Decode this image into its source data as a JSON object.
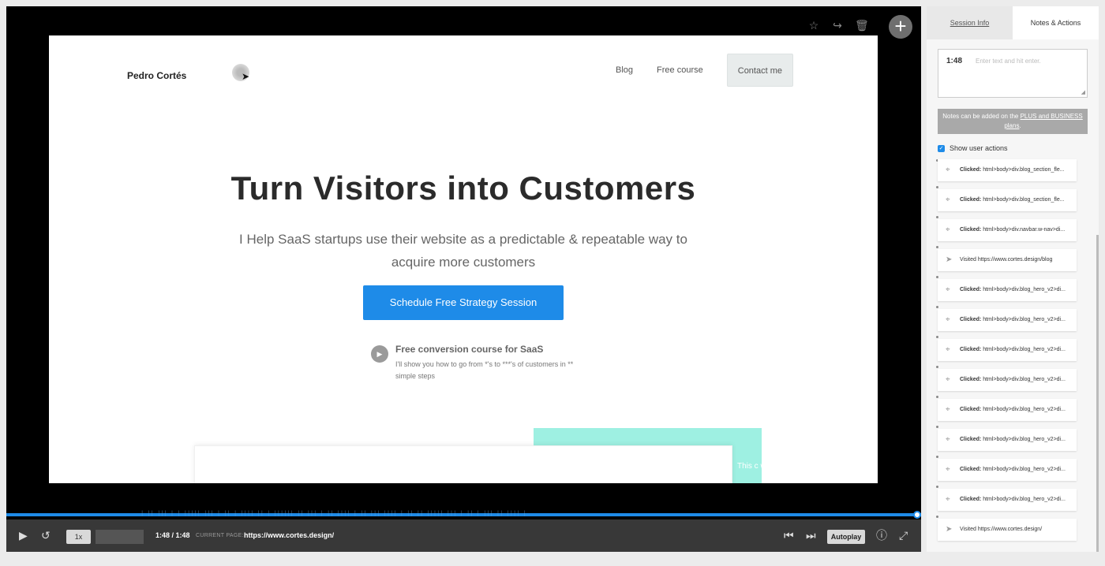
{
  "player": {
    "top_tools": [
      {
        "icon": "star-icon",
        "glyph": "☆"
      },
      {
        "icon": "share-icon",
        "glyph": "↪"
      },
      {
        "icon": "trash-icon",
        "glyph": "🗑"
      }
    ],
    "add_glyph": "+"
  },
  "site": {
    "brand": "Pedro Cortés",
    "nav": {
      "blog": "Blog",
      "free_course": "Free course",
      "contact": "Contact me"
    },
    "hero_title": "Turn Visitors into Customers",
    "hero_sub": "I Help SaaS startups use their website as a predictable & repeatable way to acquire more customers",
    "cta": "Schedule Free Strategy Session",
    "course_title": "Free conversion course for SaaS",
    "course_desc": "I'll show you how to go from *'s to ***'s of customers in ** simple steps",
    "teal_text": "This c within"
  },
  "controls": {
    "speed": "1x",
    "time": "1:48 / 1:48",
    "current_page_label": "CURRENT PAGE:",
    "current_page": "https://www.cortes.design/",
    "autoplay": "Autoplay",
    "progress": 1.0
  },
  "panel": {
    "tabs": {
      "session_info": "Session Info",
      "notes_actions": "Notes & Actions"
    },
    "note_time": "1:48",
    "note_placeholder": "Enter text and hit enter.",
    "plans_text": "Notes can be added on the",
    "plans_link": "PLUS and BUSINESS plans",
    "show_actions": "Show user actions",
    "actions": [
      {
        "type": "click",
        "label": "Clicked:",
        "text": "html>body>div.blog_section_fle..."
      },
      {
        "type": "click",
        "label": "Clicked:",
        "text": "html>body>div.blog_section_fle..."
      },
      {
        "type": "click",
        "label": "Clicked:",
        "text": "html>body>div.navbar.w-nav>di..."
      },
      {
        "type": "visit",
        "label": "",
        "text": "Visited https://www.cortes.design/blog"
      },
      {
        "type": "click",
        "label": "Clicked:",
        "text": "html>body>div.blog_hero_v2>di..."
      },
      {
        "type": "click",
        "label": "Clicked:",
        "text": "html>body>div.blog_hero_v2>di..."
      },
      {
        "type": "click",
        "label": "Clicked:",
        "text": "html>body>div.blog_hero_v2>di..."
      },
      {
        "type": "click",
        "label": "Clicked:",
        "text": "html>body>div.blog_hero_v2>di..."
      },
      {
        "type": "click",
        "label": "Clicked:",
        "text": "html>body>div.blog_hero_v2>di..."
      },
      {
        "type": "click",
        "label": "Clicked:",
        "text": "html>body>div.blog_hero_v2>di..."
      },
      {
        "type": "click",
        "label": "Clicked:",
        "text": "html>body>div.blog_hero_v2>di..."
      },
      {
        "type": "click",
        "label": "Clicked:",
        "text": "html>body>div.blog_hero_v2>di..."
      },
      {
        "type": "visit",
        "label": "",
        "text": "Visited https://www.cortes.design/"
      }
    ]
  },
  "colors": {
    "accent": "#1e8be8",
    "teal": "#9ef0e2",
    "controls_bg": "#383838"
  }
}
